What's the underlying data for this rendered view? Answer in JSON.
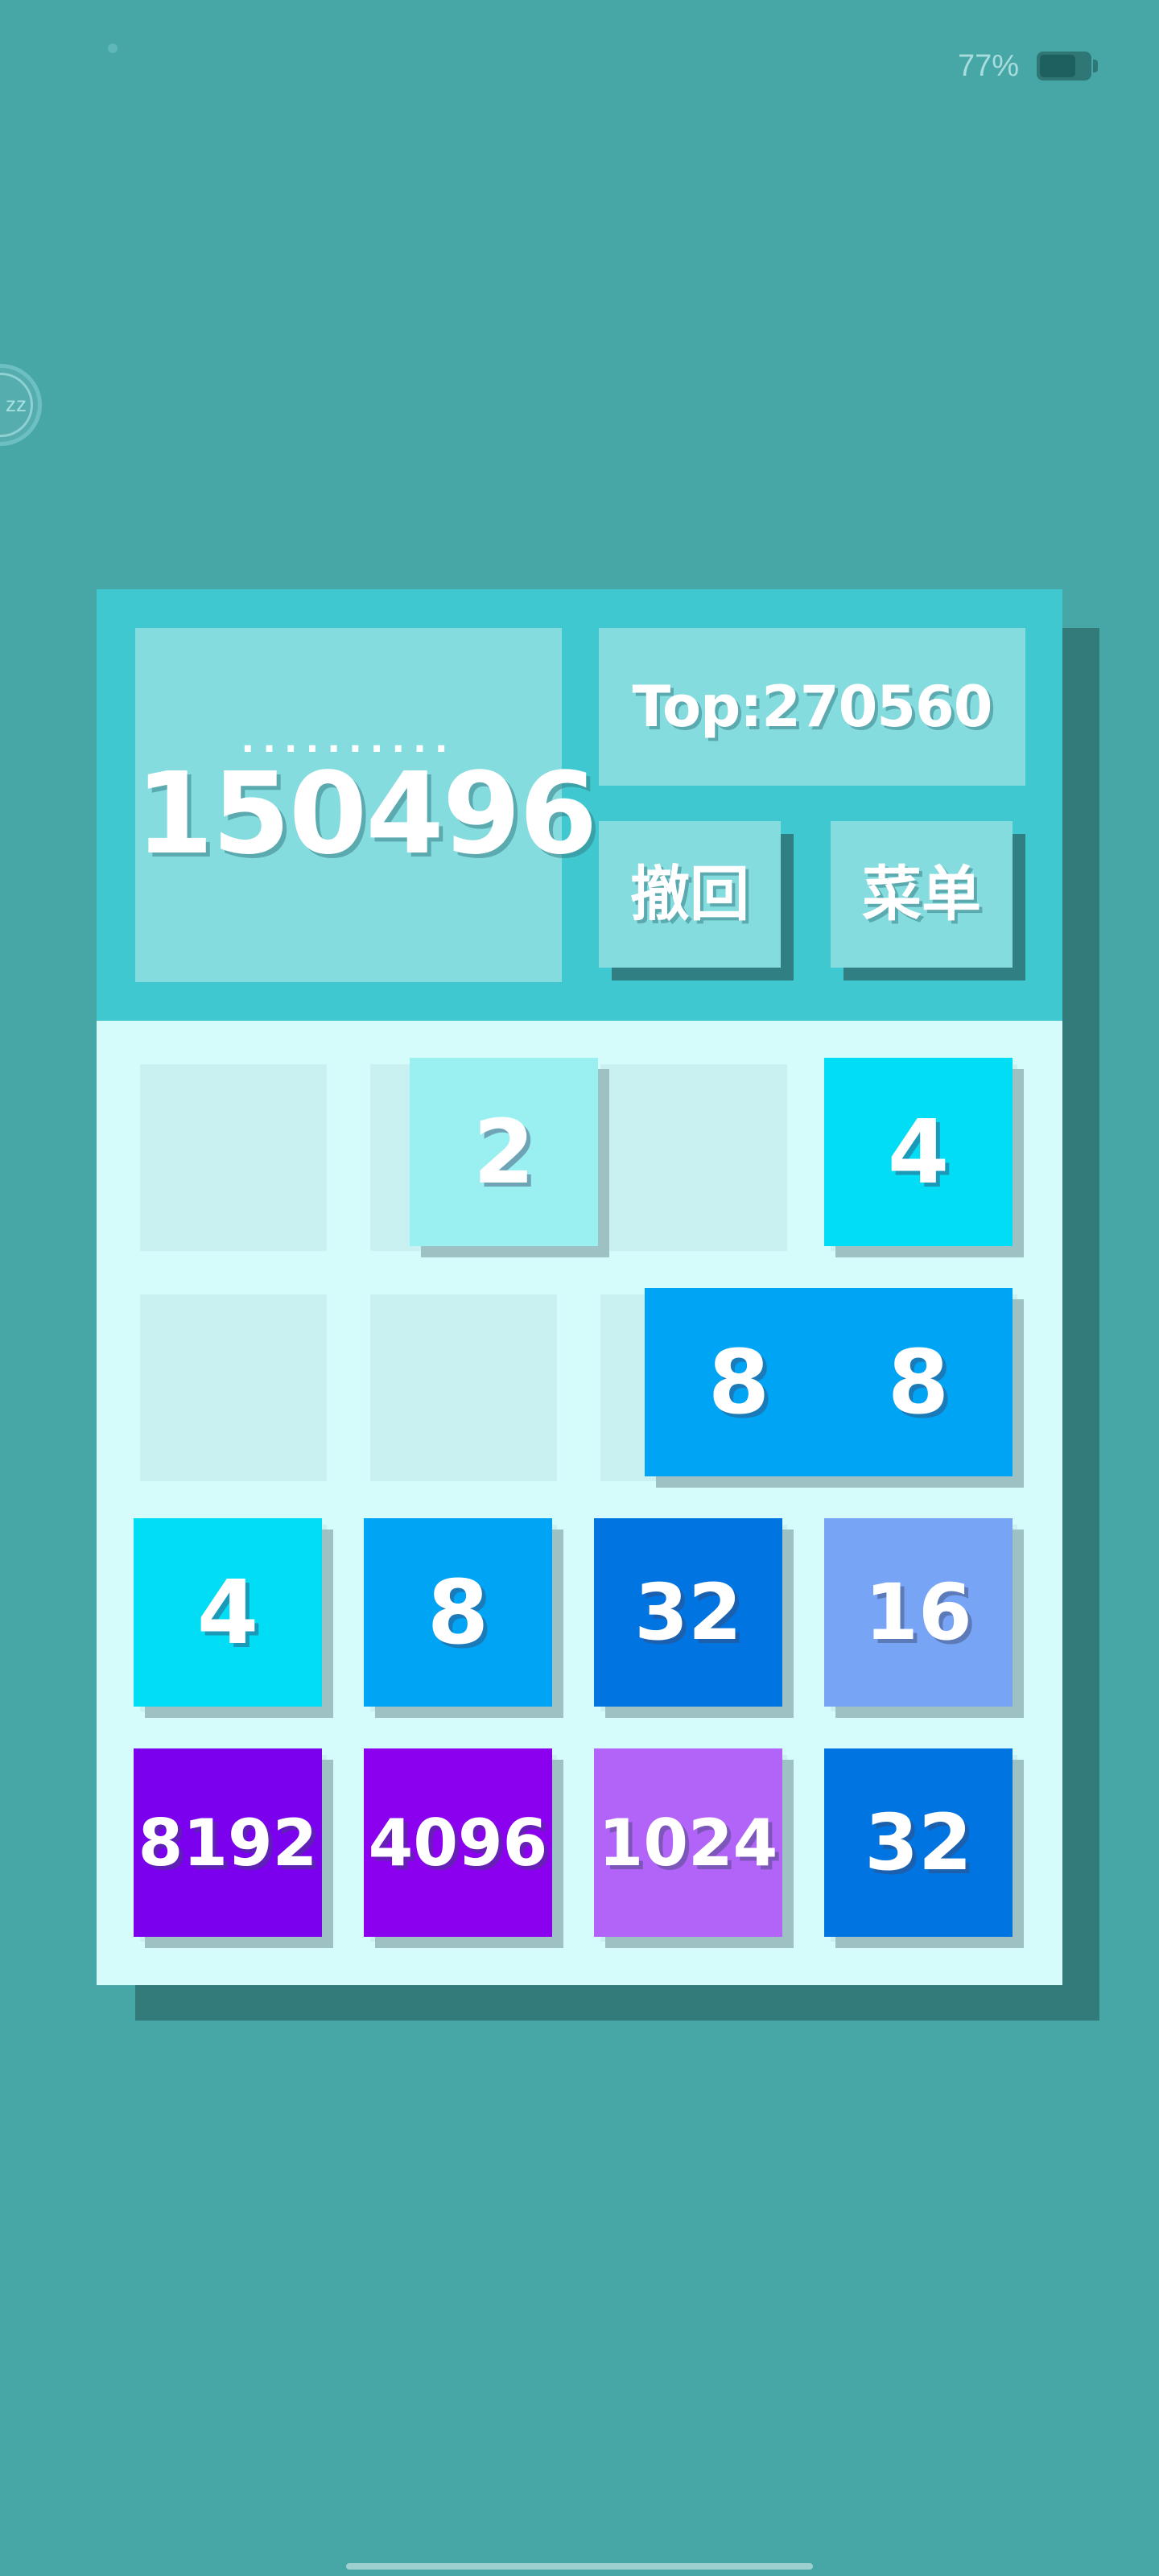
{
  "status_bar": {
    "battery_text": "77%",
    "icons": {
      "battery": "battery-icon"
    }
  },
  "edge_bubble": {
    "label": "zz",
    "icon": "sleep-bubble-icon"
  },
  "header": {
    "score_dots": "..........",
    "score": "150496",
    "top_label": "Top:270560",
    "undo_label": "撤回",
    "menu_label": "菜单"
  },
  "colors": {
    "background": "#47a7a7",
    "header": "#3fc8d0",
    "box": "#85dcdf",
    "board": "#d5fbfb",
    "empty_cell": "#c9f1f1",
    "tile_2": "#9af0f0",
    "tile_4": "#00ddf5",
    "tile_8": "#00a4f5",
    "tile_16": "#78a4f5",
    "tile_32": "#0074e0",
    "tile_1024": "#b263f8",
    "tile_4096": "#8b00ee",
    "tile_8192": "#7a00ee"
  },
  "board": {
    "rows": 4,
    "cols": 4,
    "tiles": [
      {
        "value": "2",
        "row": 0,
        "col": 1.2,
        "color": "#9af0f0",
        "size_class": "large"
      },
      {
        "value": "4",
        "row": 0,
        "col": 3,
        "color": "#00ddf5",
        "size_class": "large"
      },
      {
        "value": "8",
        "row": 1,
        "col": 2.22,
        "color": "#00a4f5",
        "size_class": "large"
      },
      {
        "value": "8",
        "row": 1,
        "col": 3,
        "color": "#00a4f5",
        "size_class": "large"
      },
      {
        "value": "4",
        "row": 2,
        "col": 0,
        "color": "#00ddf5",
        "size_class": "large"
      },
      {
        "value": "8",
        "row": 2,
        "col": 1,
        "color": "#00a4f5",
        "size_class": "large"
      },
      {
        "value": "32",
        "row": 2,
        "col": 2,
        "color": "#0074e0",
        "size_class": "medium"
      },
      {
        "value": "16",
        "row": 2,
        "col": 3,
        "color": "#78a4f5",
        "size_class": "medium"
      },
      {
        "value": "8192",
        "row": 3,
        "col": 0,
        "color": "#7a00ee",
        "size_class": "small"
      },
      {
        "value": "4096",
        "row": 3,
        "col": 1,
        "color": "#8b00ee",
        "size_class": "small"
      },
      {
        "value": "1024",
        "row": 3,
        "col": 2,
        "color": "#b263f8",
        "size_class": "small"
      },
      {
        "value": "32",
        "row": 3,
        "col": 3,
        "color": "#0074e0",
        "size_class": "medium"
      }
    ]
  }
}
